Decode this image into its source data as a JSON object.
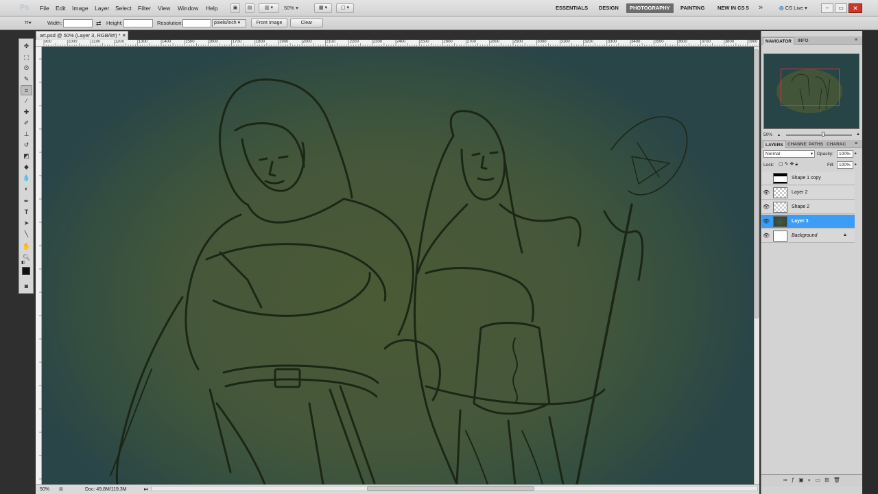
{
  "app": {
    "logo": "Ps"
  },
  "menu": [
    "File",
    "Edit",
    "Image",
    "Layer",
    "Select",
    "Filter",
    "View",
    "Window",
    "Help"
  ],
  "menubar": {
    "zoom": "50%",
    "cslive": "CS Live"
  },
  "workspaces": {
    "items": [
      "ESSENTIALS",
      "DESIGN",
      "PHOTOGRAPHY",
      "PAINTING",
      "NEW IN CS 5"
    ],
    "active": "PHOTOGRAPHY",
    "more": "»"
  },
  "options": {
    "width_label": "Width:",
    "width_value": "",
    "height_label": "Height:",
    "height_value": "",
    "resolution_label": "Resolution:",
    "resolution_value": "",
    "units": "pixels/inch",
    "front_image": "Front Image",
    "clear": "Clear"
  },
  "document": {
    "tab_title": "art.psd @ 50% (Layer 3, RGB/8#) *",
    "zoom": "50%",
    "doc_info": "Doc: 49,8M/119,3M"
  },
  "ruler": {
    "ticks": [
      "900",
      "1000",
      "1100",
      "1200",
      "1300",
      "1400",
      "1500",
      "1600",
      "1700",
      "1800",
      "1900",
      "2000",
      "2100",
      "2200",
      "2300",
      "2400",
      "2500",
      "2600",
      "2700",
      "2800",
      "2900",
      "3000",
      "3100",
      "3200",
      "3300",
      "3400",
      "3500",
      "3600",
      "3700",
      "3800",
      "3900"
    ]
  },
  "navigator": {
    "tabs": [
      "NAVIGATOR",
      "INFO"
    ],
    "zoom": "50%"
  },
  "layers": {
    "tabs": [
      "LAYERS",
      "CHANNE",
      "PATHS",
      "CHARAC"
    ],
    "blend_mode": "Normal",
    "opacity_label": "Opacity:",
    "opacity": "100%",
    "lock_label": "Lock:",
    "fill_label": "Fill:",
    "fill": "100%",
    "items": [
      {
        "name": "Shape 1 copy",
        "visible": false,
        "selected": false
      },
      {
        "name": "Layer 2",
        "visible": true,
        "selected": false
      },
      {
        "name": "Shape 2",
        "visible": true,
        "selected": false
      },
      {
        "name": "Layer 3",
        "visible": true,
        "selected": true
      },
      {
        "name": "Background",
        "visible": true,
        "selected": false
      }
    ]
  },
  "colors": {
    "accent": "#3d9df5",
    "canvas_bg": "#2a4547",
    "sketch_glow": "#4a5a35",
    "line": "#1c2616"
  }
}
